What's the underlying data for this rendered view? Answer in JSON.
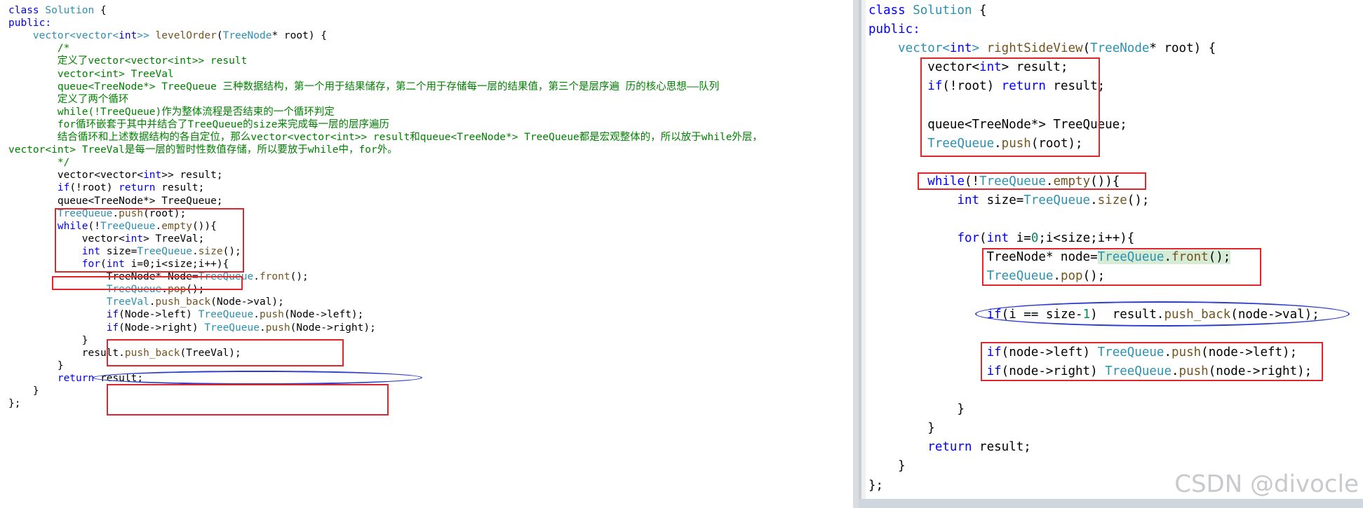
{
  "left_panel": {
    "lines": [
      [
        [
          "class ",
          "kw"
        ],
        [
          "Solution",
          "ty"
        ],
        [
          " {",
          ""
        ]
      ],
      [
        [
          "public:",
          "kw"
        ]
      ],
      [
        [
          "    vector<vector<",
          "ty"
        ],
        [
          "int",
          "kw"
        ],
        [
          ">> ",
          "ty"
        ],
        [
          "levelOrder",
          "fn"
        ],
        [
          "(",
          ""
        ],
        [
          "TreeNode",
          "ty"
        ],
        [
          "* ",
          ""
        ],
        [
          "root",
          ""
        ],
        [
          ") {",
          ""
        ]
      ],
      [
        [
          "        /*",
          "cm"
        ]
      ],
      [
        [
          "        定义了vector<vector<int>> result",
          "cm"
        ]
      ],
      [
        [
          "        vector<int> TreeVal",
          "cm"
        ]
      ],
      [
        [
          "        queue<TreeNode*> TreeQueue 三种数据结构，第一个用于结果储存，第二个用于存储每一层的结果值，第三个是层序遍 历的核心思想——队列",
          "cm"
        ]
      ],
      [
        [
          "        定义了两个循环",
          "cm"
        ]
      ],
      [
        [
          "        while(!TreeQueue)作为整体流程是否结束的一个循环判定",
          "cm"
        ]
      ],
      [
        [
          "        for循环嵌套于其中并结合了TreeQueue的size来完成每一层的层序遍历",
          "cm"
        ]
      ],
      [
        [
          "        结合循环和上述数据结构的各自定位，那么vector<vector<int>> result和queue<TreeNode*> TreeQueue都是宏观整体的，所以放于while外层，",
          "cm"
        ]
      ],
      [
        [
          "vector<int> TreeVal是每一层的暂时性数值存储，所以要放于while中，for外。",
          "cm"
        ]
      ],
      [
        [
          "        */",
          "cm"
        ]
      ],
      [
        [
          "        vector<vector<",
          ""
        ],
        [
          "int",
          "kw"
        ],
        [
          ">> result;",
          ""
        ]
      ],
      [
        [
          "        ",
          ""
        ],
        [
          "if",
          "kw"
        ],
        [
          "(!root) ",
          ""
        ],
        [
          "return",
          "kw"
        ],
        [
          " result;",
          ""
        ]
      ],
      [
        [
          "        queue<TreeNode*> TreeQueue;",
          ""
        ]
      ],
      [
        [
          "        ",
          ""
        ],
        [
          "TreeQueue",
          "ty"
        ],
        [
          ".",
          ""
        ],
        [
          "push",
          "fn"
        ],
        [
          "(root);",
          ""
        ]
      ],
      [
        [
          "        ",
          ""
        ],
        [
          "while",
          "kw"
        ],
        [
          "(!",
          ""
        ],
        [
          "TreeQueue",
          "ty"
        ],
        [
          ".",
          ""
        ],
        [
          "empty",
          "fn"
        ],
        [
          "()){",
          ""
        ]
      ],
      [
        [
          "            vector<",
          ""
        ],
        [
          "int",
          "kw"
        ],
        [
          "> TreeVal;",
          ""
        ]
      ],
      [
        [
          "            ",
          ""
        ],
        [
          "int",
          "kw"
        ],
        [
          " size=",
          ""
        ],
        [
          "TreeQueue",
          "ty"
        ],
        [
          ".",
          ""
        ],
        [
          "size",
          "fn"
        ],
        [
          "();",
          ""
        ]
      ],
      [
        [
          "            ",
          ""
        ],
        [
          "for",
          "kw"
        ],
        [
          "(",
          ""
        ],
        [
          "int",
          "kw"
        ],
        [
          " i=0;i<size;i++){",
          ""
        ]
      ],
      [
        [
          "                TreeNode* Node=",
          ""
        ],
        [
          "TreeQueue",
          "ty"
        ],
        [
          ".",
          ""
        ],
        [
          "front",
          "fn"
        ],
        [
          "();",
          ""
        ]
      ],
      [
        [
          "                ",
          ""
        ],
        [
          "TreeQueue",
          "ty"
        ],
        [
          ".",
          ""
        ],
        [
          "pop",
          "fn"
        ],
        [
          "();",
          ""
        ]
      ],
      [
        [
          "                ",
          ""
        ],
        [
          "TreeVal",
          "ty"
        ],
        [
          ".",
          ""
        ],
        [
          "push_back",
          "fn"
        ],
        [
          "(Node->val);",
          ""
        ]
      ],
      [
        [
          "                ",
          ""
        ],
        [
          "if",
          "kw"
        ],
        [
          "(Node->left) ",
          ""
        ],
        [
          "TreeQueue",
          "ty"
        ],
        [
          ".",
          ""
        ],
        [
          "push",
          "fn"
        ],
        [
          "(Node->left);",
          ""
        ]
      ],
      [
        [
          "                ",
          ""
        ],
        [
          "if",
          "kw"
        ],
        [
          "(Node->right) ",
          ""
        ],
        [
          "TreeQueue",
          "ty"
        ],
        [
          ".",
          ""
        ],
        [
          "push",
          "fn"
        ],
        [
          "(Node->right);",
          ""
        ]
      ],
      [
        [
          "            }",
          ""
        ]
      ],
      [
        [
          "            result.",
          ""
        ],
        [
          "push_back",
          "fn"
        ],
        [
          "(TreeVal);",
          ""
        ]
      ],
      [
        [
          "        }",
          ""
        ]
      ],
      [
        [
          "        ",
          ""
        ],
        [
          "return",
          "kw"
        ],
        [
          " result;",
          ""
        ]
      ],
      [
        [
          "    }",
          ""
        ]
      ],
      [
        [
          "};",
          ""
        ]
      ]
    ]
  },
  "right_panel": {
    "lines": [
      [
        [
          "class ",
          "kw"
        ],
        [
          "Solution",
          "ty"
        ],
        [
          " {",
          ""
        ]
      ],
      [
        [
          "public:",
          "kw"
        ]
      ],
      [
        [
          "    vector<",
          "ty"
        ],
        [
          "int",
          "kw"
        ],
        [
          "> ",
          "ty"
        ],
        [
          "rightSideView",
          "fn"
        ],
        [
          "(",
          ""
        ],
        [
          "TreeNode",
          "ty"
        ],
        [
          "* root) {",
          ""
        ]
      ],
      [
        [
          "        vector<",
          ""
        ],
        [
          "int",
          "kw"
        ],
        [
          "> result;",
          ""
        ]
      ],
      [
        [
          "        ",
          ""
        ],
        [
          "if",
          "kw"
        ],
        [
          "(!root) ",
          ""
        ],
        [
          "return",
          "kw"
        ],
        [
          " result;",
          ""
        ]
      ],
      [
        [
          "",
          ""
        ]
      ],
      [
        [
          "        queue<TreeNode*> TreeQueue;",
          ""
        ]
      ],
      [
        [
          "        ",
          ""
        ],
        [
          "TreeQueue",
          "ty"
        ],
        [
          ".",
          ""
        ],
        [
          "push",
          "fn"
        ],
        [
          "(root);",
          ""
        ]
      ],
      [
        [
          "",
          ""
        ]
      ],
      [
        [
          "        ",
          ""
        ],
        [
          "while",
          "kw"
        ],
        [
          "(!",
          ""
        ],
        [
          "TreeQueue",
          "ty"
        ],
        [
          ".",
          ""
        ],
        [
          "empty",
          "fn"
        ],
        [
          "()){",
          ""
        ]
      ],
      [
        [
          "            ",
          ""
        ],
        [
          "int",
          "kw"
        ],
        [
          " size=",
          ""
        ],
        [
          "TreeQueue",
          "ty"
        ],
        [
          ".",
          ""
        ],
        [
          "size",
          "fn"
        ],
        [
          "();",
          ""
        ]
      ],
      [
        [
          "",
          ""
        ]
      ],
      [
        [
          "            ",
          ""
        ],
        [
          "for",
          "kw"
        ],
        [
          "(",
          ""
        ],
        [
          "int",
          "kw"
        ],
        [
          " i=",
          ""
        ],
        [
          "0",
          "num"
        ],
        [
          ";i<size;i++){",
          ""
        ]
      ],
      [
        [
          "                TreeNode* node=",
          ""
        ],
        [
          "TreeQueue",
          "ty"
        ],
        [
          ".",
          ""
        ],
        [
          "front",
          "fn"
        ],
        [
          "();",
          ""
        ]
      ],
      [
        [
          "                ",
          ""
        ],
        [
          "TreeQueue",
          "ty"
        ],
        [
          ".",
          ""
        ],
        [
          "pop",
          "fn"
        ],
        [
          "();",
          ""
        ]
      ],
      [
        [
          "",
          ""
        ]
      ],
      [
        [
          "                ",
          ""
        ],
        [
          "if",
          "kw"
        ],
        [
          "(i == size-",
          ""
        ],
        [
          "1",
          "num"
        ],
        [
          ")  result.",
          ""
        ],
        [
          "push_back",
          "fn"
        ],
        [
          "(node->val);",
          ""
        ]
      ],
      [
        [
          "",
          ""
        ]
      ],
      [
        [
          "                ",
          ""
        ],
        [
          "if",
          "kw"
        ],
        [
          "(node->left) ",
          ""
        ],
        [
          "TreeQueue",
          "ty"
        ],
        [
          ".",
          ""
        ],
        [
          "push",
          "fn"
        ],
        [
          "(node->left);",
          ""
        ]
      ],
      [
        [
          "                ",
          ""
        ],
        [
          "if",
          "kw"
        ],
        [
          "(node->right) ",
          ""
        ],
        [
          "TreeQueue",
          "ty"
        ],
        [
          ".",
          ""
        ],
        [
          "push",
          "fn"
        ],
        [
          "(node->right);",
          ""
        ]
      ],
      [
        [
          "",
          ""
        ]
      ],
      [
        [
          "            }",
          ""
        ]
      ],
      [
        [
          "        }",
          ""
        ]
      ],
      [
        [
          "        ",
          ""
        ],
        [
          "return",
          "kw"
        ],
        [
          " result;",
          ""
        ]
      ],
      [
        [
          "    }",
          ""
        ]
      ],
      [
        [
          "};",
          ""
        ]
      ]
    ]
  },
  "watermark": "CSDN @divocle",
  "colors": {
    "keyword": "#0000ff",
    "type": "#2b91af",
    "function": "#74531f",
    "comment": "#008000",
    "annotation_red": "#e0262d",
    "annotation_blue": "#2b3ec9"
  }
}
